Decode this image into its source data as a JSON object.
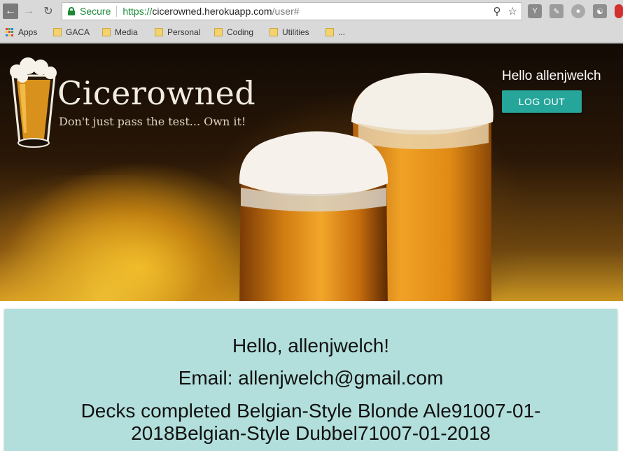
{
  "browser": {
    "secure_label": "Secure",
    "url_proto": "https://",
    "url_host": "cicerowned.herokuapp.com",
    "url_path": "/user#",
    "bookmarks": [
      "Apps",
      "GACA",
      "Media",
      "Personal",
      "Coding",
      "Utilities",
      "..."
    ]
  },
  "site": {
    "brand_title": "Cicerowned",
    "brand_tagline": "Don't just pass the test... Own it!",
    "header_greeting": "Hello allenjwelch",
    "logout_label": "LOG OUT"
  },
  "profile": {
    "greeting": "Hello, allenjwelch!",
    "email_line": "Email: allenjwelch@gmail.com",
    "decks_line": "Decks completed Belgian-Style Blonde Ale91007-01-2018Belgian-Style Dubbel71007-01-2018"
  },
  "colors": {
    "accent": "#26a69a",
    "panel": "#b2dfdb",
    "secure_green": "#1b8a36"
  }
}
